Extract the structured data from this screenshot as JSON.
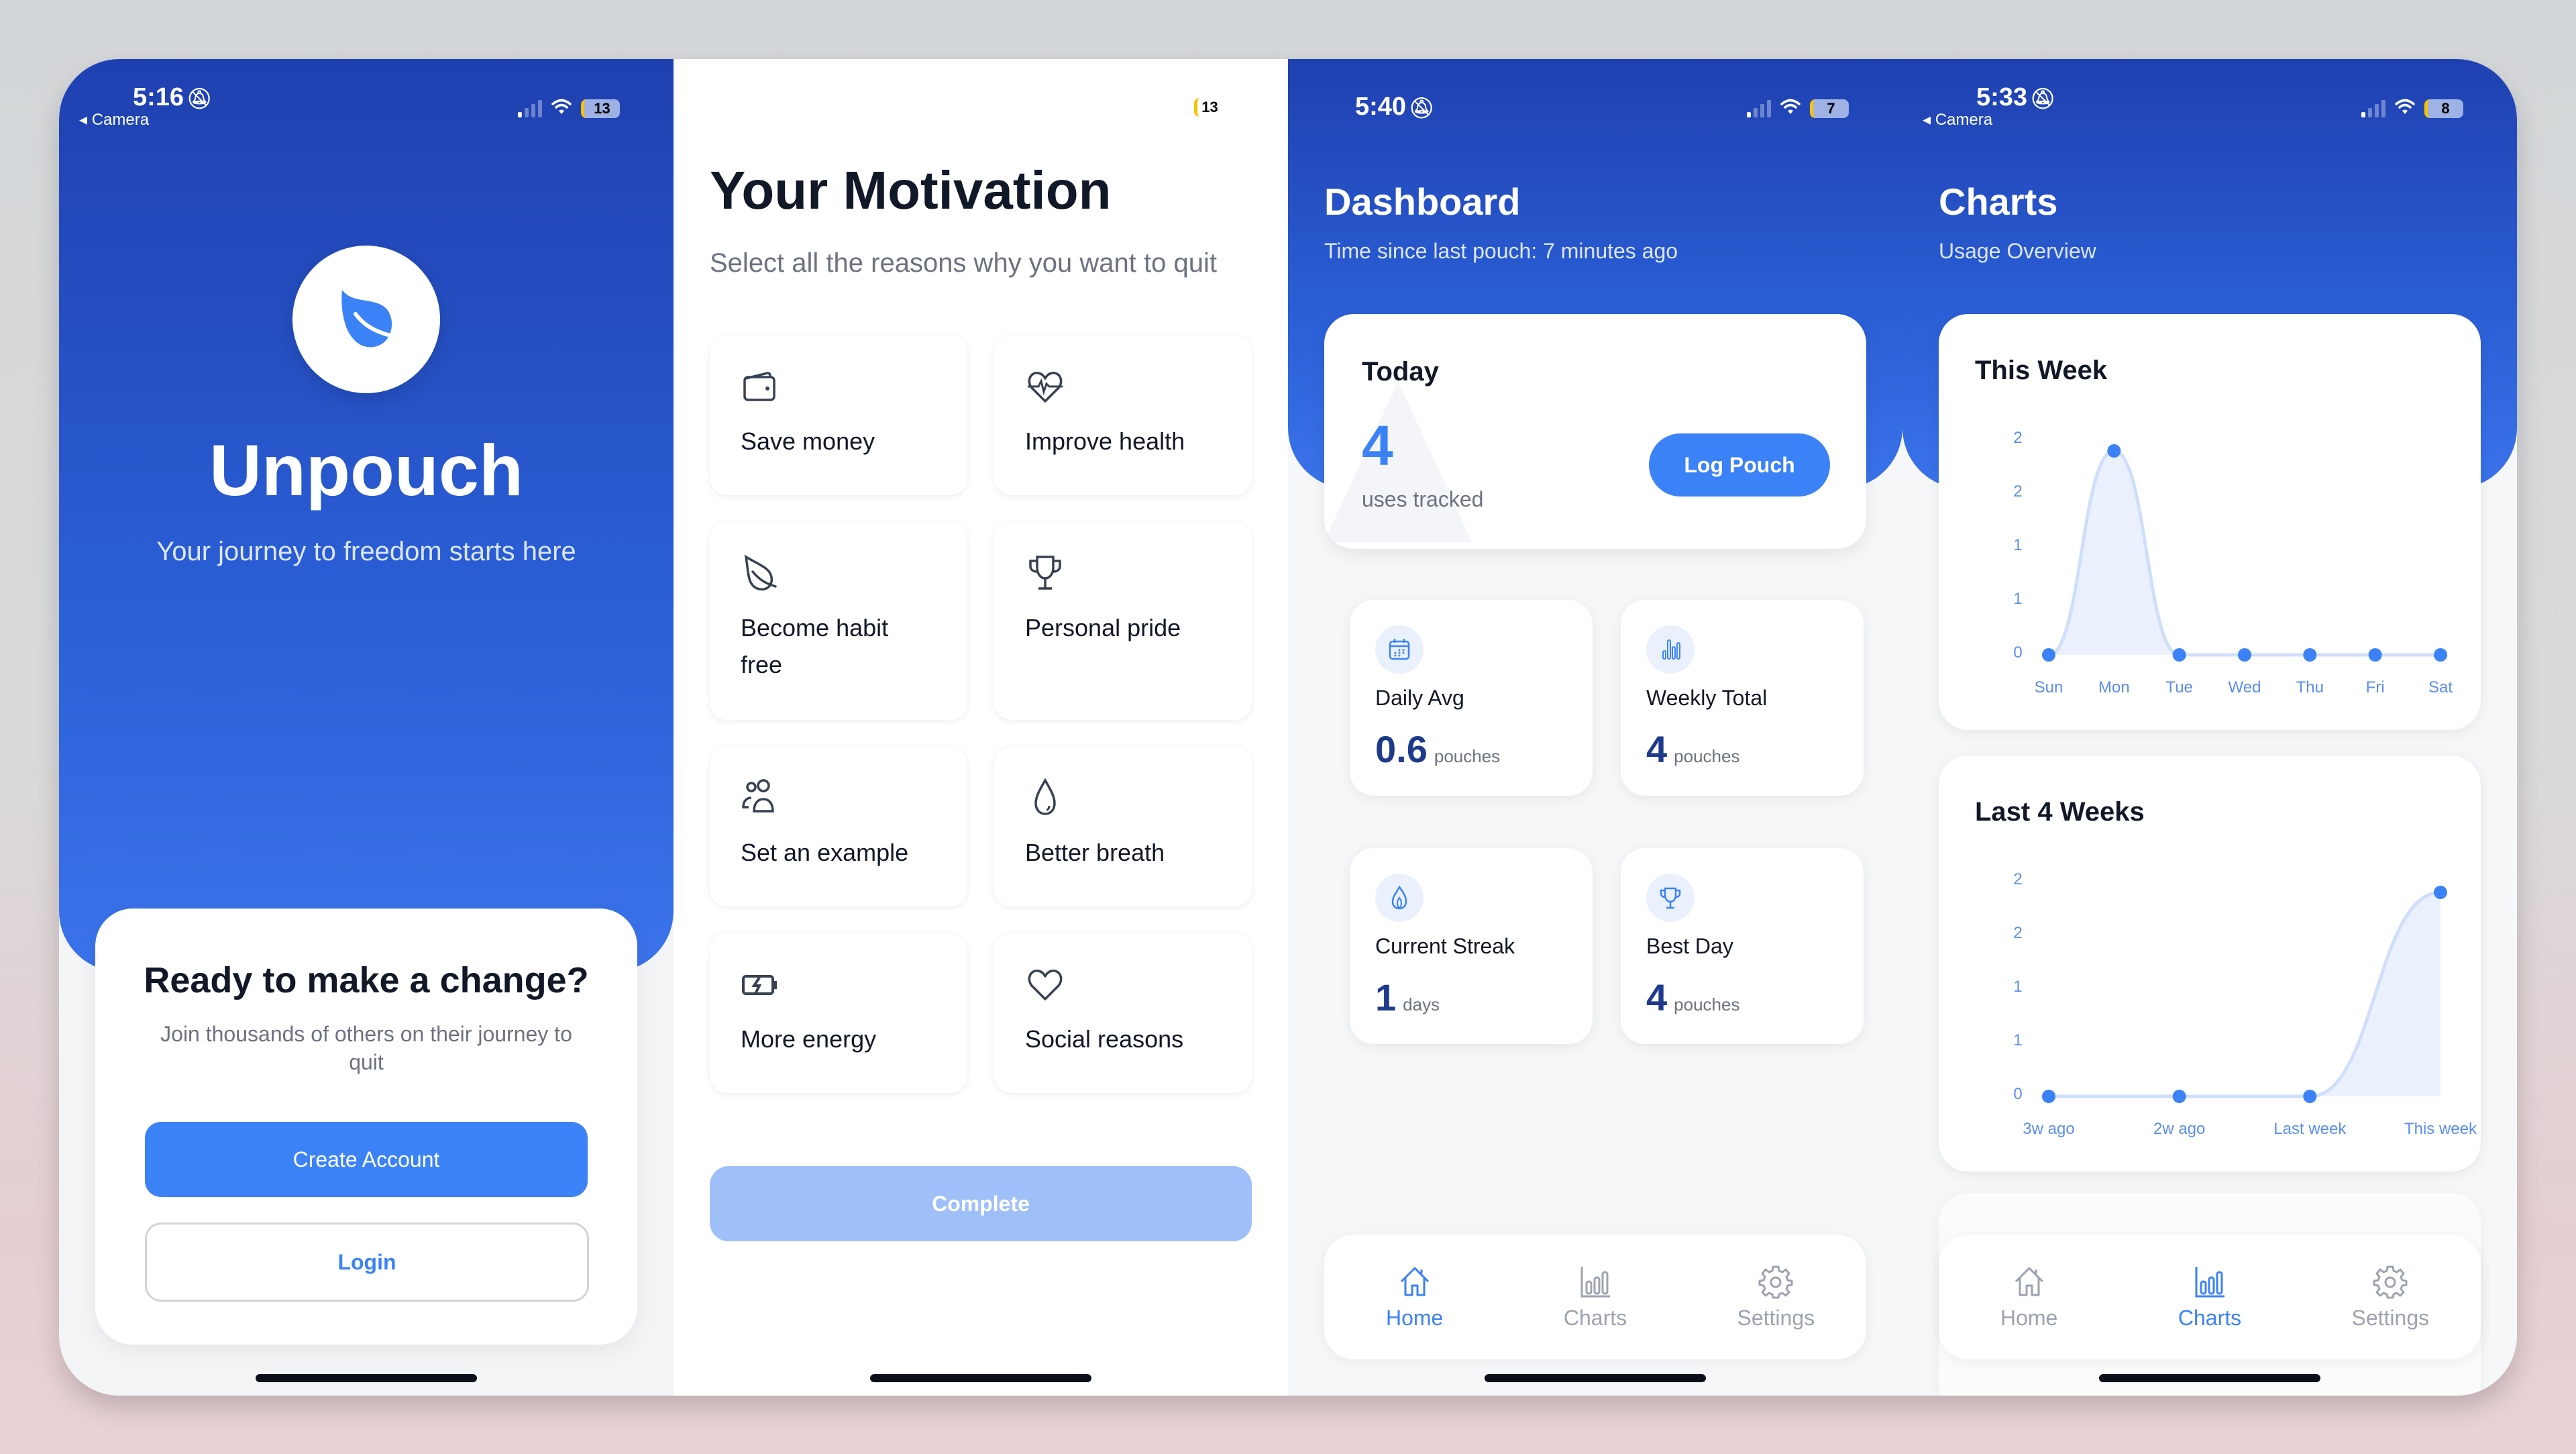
{
  "screens": {
    "welcome": {
      "status": {
        "time": "5:16",
        "back_label": "Camera",
        "battery": "13"
      },
      "app_name": "Unpouch",
      "tagline": "Your journey to freedom starts here",
      "card": {
        "title": "Ready to make a change?",
        "subtitle": "Join thousands of others on their journey to quit",
        "create_account_label": "Create Account",
        "login_label": "Login"
      }
    },
    "motivation": {
      "status": {
        "battery": "13"
      },
      "title": "Your Motivation",
      "subtitle": "Select all the reasons why you want to quit",
      "reasons": [
        {
          "label": "Save money",
          "icon": "wallet-icon"
        },
        {
          "label": "Improve health",
          "icon": "heart-pulse-icon"
        },
        {
          "label": "Become habit free",
          "icon": "leaf-icon"
        },
        {
          "label": "Personal pride",
          "icon": "trophy-icon"
        },
        {
          "label": "Set an example",
          "icon": "users-icon"
        },
        {
          "label": "Better breath",
          "icon": "droplet-icon"
        },
        {
          "label": "More energy",
          "icon": "battery-charging-icon"
        },
        {
          "label": "Social reasons",
          "icon": "heart-icon"
        }
      ],
      "complete_label": "Complete"
    },
    "dashboard": {
      "status": {
        "time": "5:40",
        "battery": "7"
      },
      "title": "Dashboard",
      "subtitle": "Time since last pouch: 7 minutes ago",
      "today": {
        "label": "Today",
        "count": "4",
        "count_label": "uses tracked",
        "log_button": "Log Pouch"
      },
      "stats": [
        {
          "label": "Daily Avg",
          "value": "0.6",
          "unit": "pouches",
          "icon": "calendar-icon"
        },
        {
          "label": "Weekly Total",
          "value": "4",
          "unit": "pouches",
          "icon": "bar-chart-icon"
        },
        {
          "label": "Current Streak",
          "value": "1",
          "unit": "days",
          "icon": "flame-icon"
        },
        {
          "label": "Best Day",
          "value": "4",
          "unit": "pouches",
          "icon": "trophy-icon"
        }
      ],
      "tabs": [
        {
          "label": "Home",
          "active": true
        },
        {
          "label": "Charts",
          "active": false
        },
        {
          "label": "Settings",
          "active": false
        }
      ]
    },
    "charts": {
      "status": {
        "time": "5:33",
        "back_label": "Camera",
        "battery": "8"
      },
      "title": "Charts",
      "subtitle": "Usage Overview",
      "tabs": [
        {
          "label": "Home",
          "active": false
        },
        {
          "label": "Charts",
          "active": true
        },
        {
          "label": "Settings",
          "active": false
        }
      ]
    }
  },
  "colors": {
    "accent": "#3b82f6",
    "hero_dark": "#1f40b0",
    "value_dark": "#1e3a8a",
    "complete_disabled": "#9ebff8"
  },
  "chart_data": [
    {
      "type": "area",
      "title": "This Week",
      "categories": [
        "Sun",
        "Mon",
        "Tue",
        "Wed",
        "Thu",
        "Fri",
        "Sat"
      ],
      "values": [
        0,
        1.9,
        0,
        0,
        0,
        0,
        0
      ],
      "ytick_labels": [
        "0",
        "1",
        "1",
        "2",
        "2"
      ],
      "ylim": [
        0,
        2
      ],
      "grid": false,
      "legend": "none"
    },
    {
      "type": "area",
      "title": "Last 4 Weeks",
      "categories": [
        "3w ago",
        "2w ago",
        "Last week",
        "This week"
      ],
      "values": [
        0,
        0,
        0,
        1.9
      ],
      "ytick_labels": [
        "0",
        "1",
        "1",
        "2",
        "2"
      ],
      "ylim": [
        0,
        2
      ],
      "grid": false,
      "legend": "none"
    }
  ]
}
